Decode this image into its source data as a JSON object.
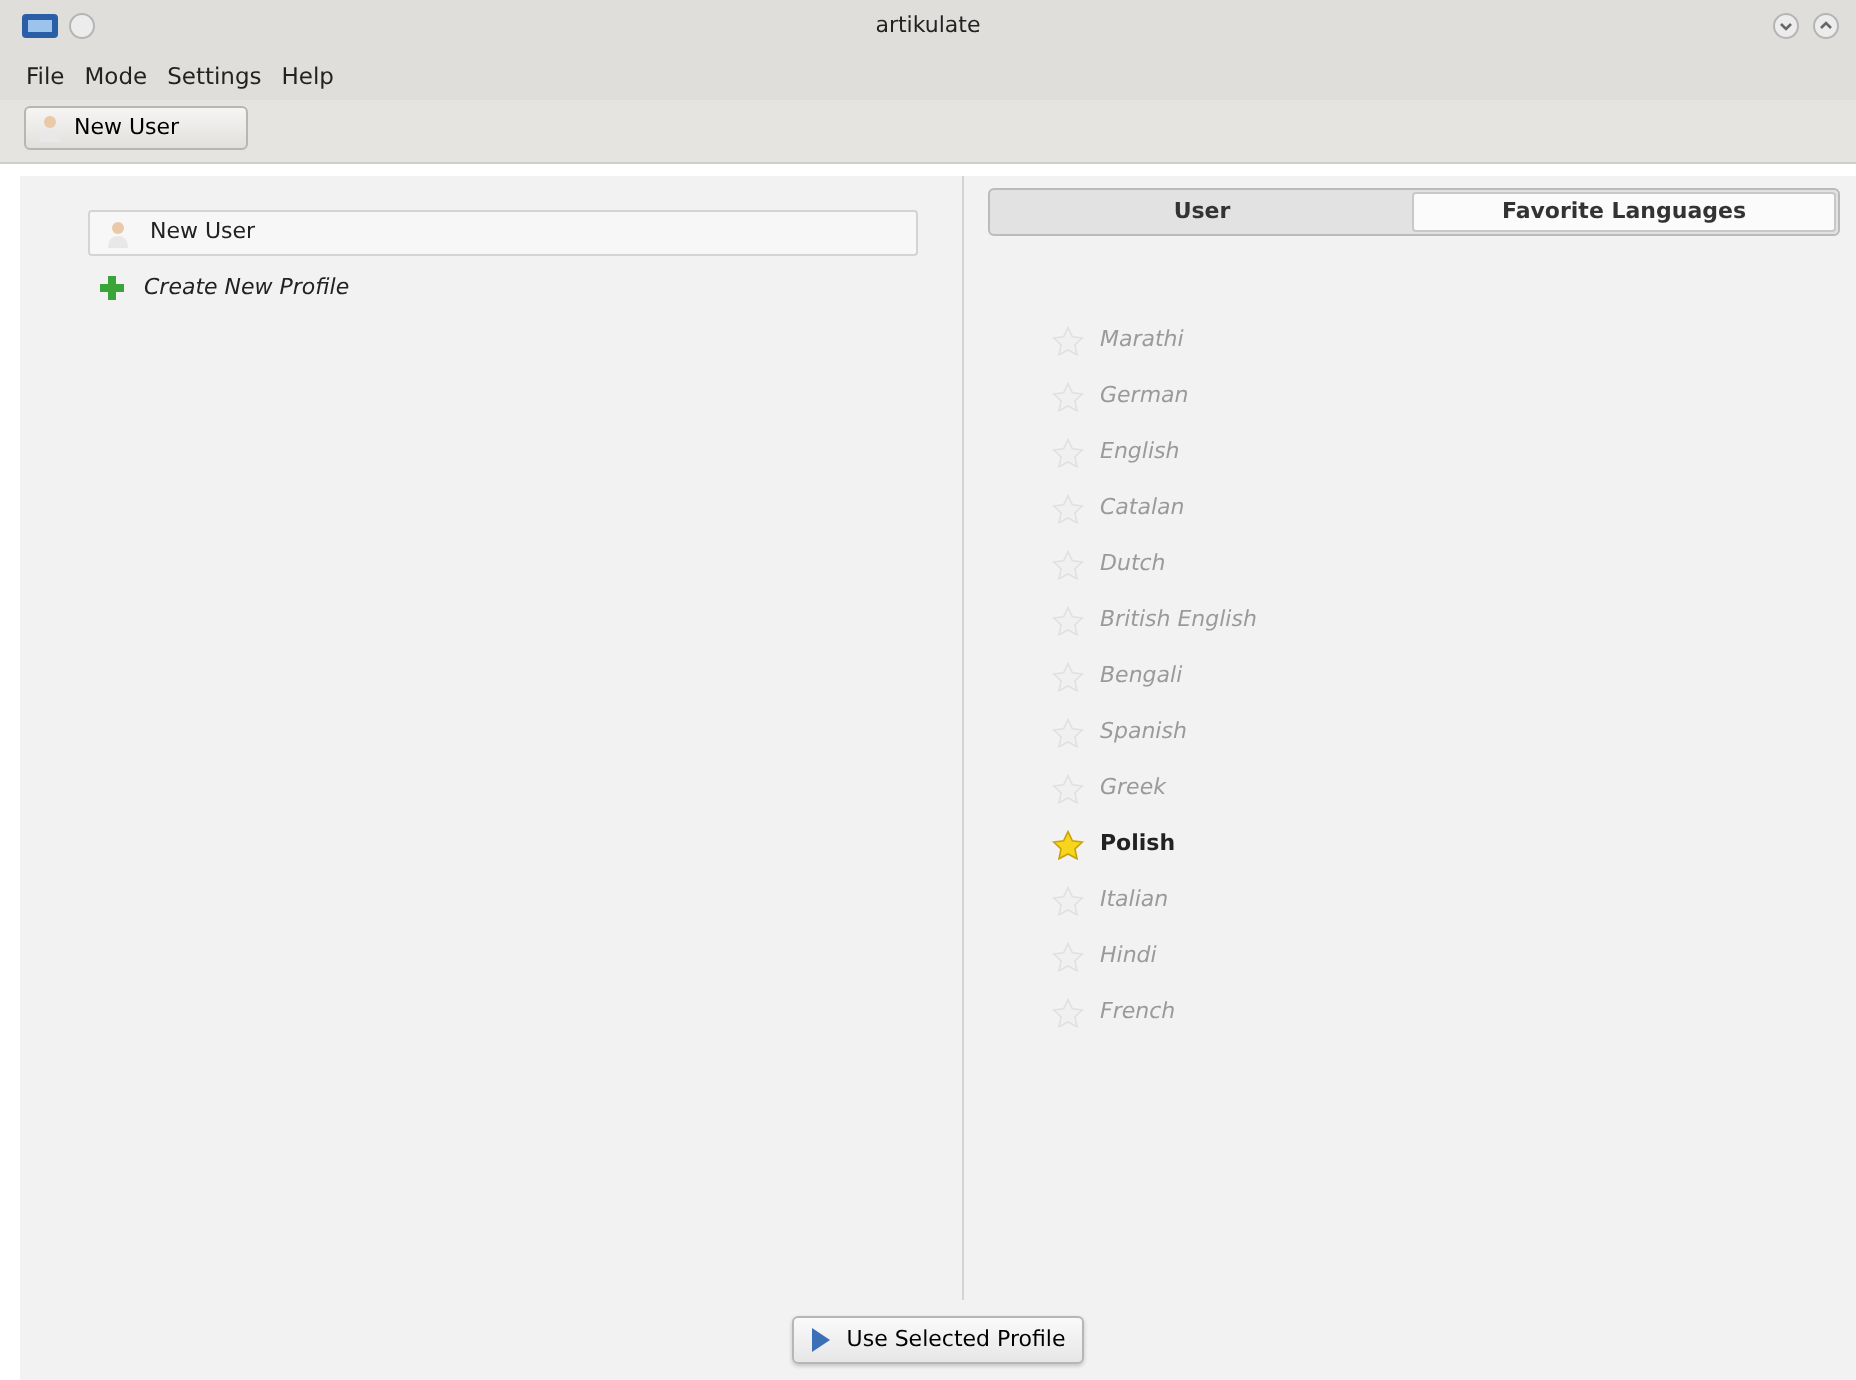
{
  "window": {
    "title": "artikulate"
  },
  "menu": [
    "File",
    "Mode",
    "Settings",
    "Help"
  ],
  "toolbar": {
    "profile_button": "New User"
  },
  "profiles": [
    {
      "name": "New User",
      "selected": true
    }
  ],
  "create_profile": "Create New Profile",
  "tabs": [
    {
      "label": "User",
      "selected": false
    },
    {
      "label": "Favorite Languages",
      "selected": true
    }
  ],
  "languages": [
    {
      "name": "Marathi",
      "favorite": false
    },
    {
      "name": "German",
      "favorite": false
    },
    {
      "name": "English",
      "favorite": false
    },
    {
      "name": "Catalan",
      "favorite": false
    },
    {
      "name": "Dutch",
      "favorite": false
    },
    {
      "name": "British English",
      "favorite": false
    },
    {
      "name": "Bengali",
      "favorite": false
    },
    {
      "name": "Spanish",
      "favorite": false
    },
    {
      "name": "Greek",
      "favorite": false
    },
    {
      "name": "Polish",
      "favorite": true
    },
    {
      "name": "Italian",
      "favorite": false
    },
    {
      "name": "Hindi",
      "favorite": false
    },
    {
      "name": "French",
      "favorite": false
    }
  ],
  "use_button": "Use Selected Profile"
}
